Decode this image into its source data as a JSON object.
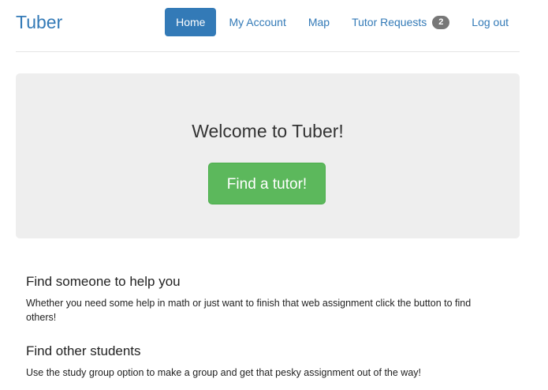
{
  "brand": "Tuber",
  "nav": {
    "home": "Home",
    "account": "My Account",
    "map": "Map",
    "requests": "Tutor Requests",
    "requests_badge": "2",
    "logout": "Log out"
  },
  "jumbotron": {
    "title": "Welcome to Tuber!",
    "button": "Find a tutor!"
  },
  "sections": [
    {
      "heading": "Find someone to help you",
      "body": "Whether you need some help in math or just want to finish that web assignment click the button to find others!"
    },
    {
      "heading": "Find other students",
      "body": "Use the study group option to make a group and get that pesky assignment out of the way!"
    }
  ],
  "colors": {
    "brand": "#337ab7",
    "primary": "#337ab7",
    "success": "#5cb85c",
    "badge": "#777777",
    "jumbotron_bg": "#eeeeee"
  }
}
